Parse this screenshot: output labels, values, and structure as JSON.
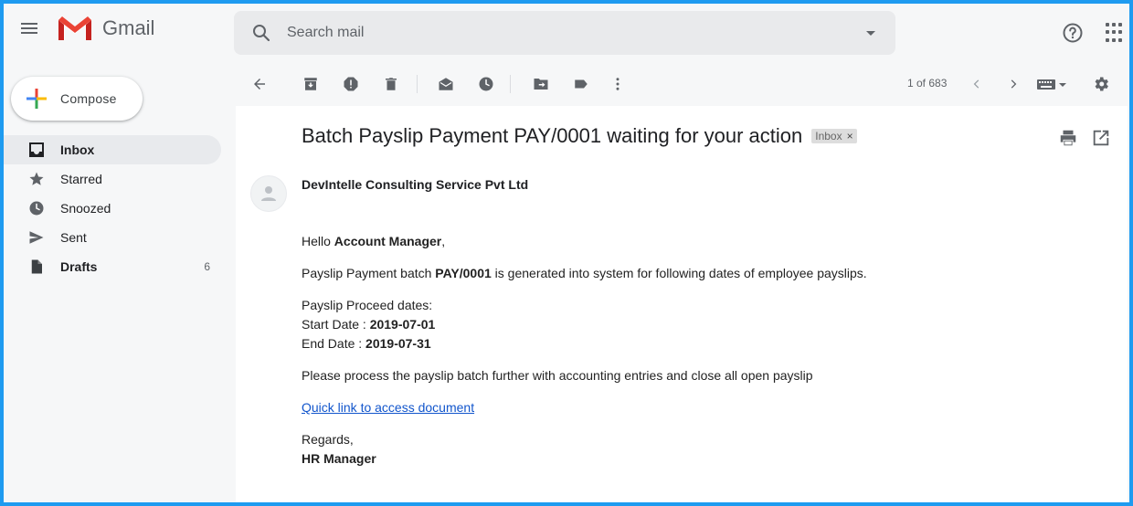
{
  "app": {
    "name": "Gmail"
  },
  "search": {
    "placeholder": "Search mail"
  },
  "compose": {
    "label": "Compose"
  },
  "sidebar": {
    "items": [
      {
        "label": "Inbox",
        "icon": "inbox-icon",
        "count": ""
      },
      {
        "label": "Starred",
        "icon": "star-icon",
        "count": ""
      },
      {
        "label": "Snoozed",
        "icon": "clock-icon",
        "count": ""
      },
      {
        "label": "Sent",
        "icon": "send-icon",
        "count": ""
      },
      {
        "label": "Drafts",
        "icon": "draft-icon",
        "count": "6"
      }
    ]
  },
  "toolbar": {
    "pager": "1 of 683",
    "icons": [
      "back-icon",
      "archive-icon",
      "report-spam-icon",
      "delete-icon",
      "mark-unread-icon",
      "snooze-icon",
      "move-to-icon",
      "label-icon",
      "more-icon",
      "prev-icon",
      "next-icon",
      "keyboard-icon",
      "settings-icon"
    ]
  },
  "email": {
    "subject": "Batch Payslip Payment PAY/0001 waiting for your action",
    "label": "Inbox",
    "label_close": "×",
    "sender": "DevIntelle Consulting Service Pvt Ltd",
    "greeting_prefix": "Hello ",
    "greeting_name": "Account Manager",
    "greeting_suffix": ",",
    "line1_prefix": "Payslip Payment batch ",
    "line1_ref": "PAY/0001",
    "line1_suffix": " is generated into system for following dates of employee payslips.",
    "dates_heading": "Payslip Proceed dates:",
    "start_label": "Start Date : ",
    "start_value": "2019-07-01",
    "end_label": "End Date : ",
    "end_value": "2019-07-31",
    "instruction": "Please process the payslip batch further with accounting entries and close all open payslip",
    "link_text": "Quick link to access document",
    "regards": "Regards,",
    "signature": "HR Manager"
  },
  "colors": {
    "accent": "#1e9bf0",
    "link": "#1155cc",
    "active_nav": "#e8eaed"
  }
}
